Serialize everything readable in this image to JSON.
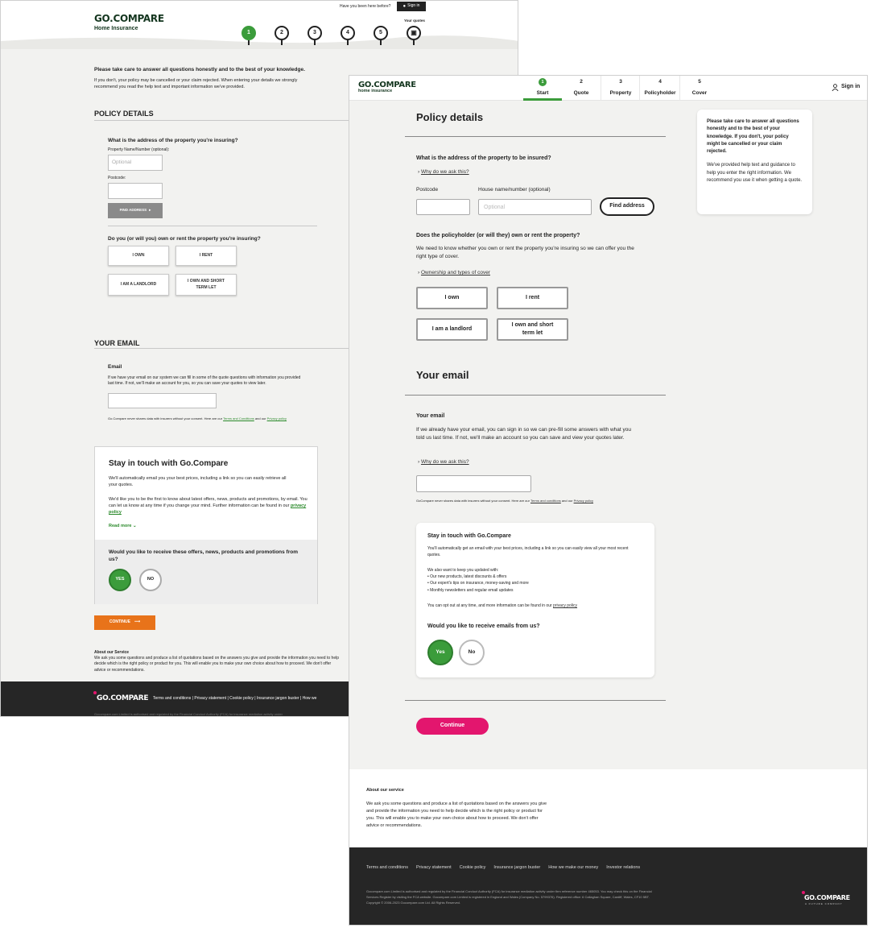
{
  "old": {
    "logo": "GO.COMPARE",
    "product": "Home Insurance",
    "been_before": "Have you been here before?",
    "sign_in": "Sign in",
    "your_quotes": "Your quotes",
    "steps": [
      "1",
      "2",
      "3",
      "4",
      "5"
    ],
    "intro_heading": "Please take care to answer all questions honestly and to the best of your knowledge.",
    "intro_text": "If you don't, your policy may be cancelled or your claim rejected. When entering your details we strongly recommend you read the help text and important information we've provided.",
    "policy_details": "POLICY DETAILS",
    "address_q": "What is the address of the property you're insuring?",
    "prop_name_label": "Property Name/Number (optional):",
    "prop_name_placeholder": "Optional",
    "postcode_label": "Postcode:",
    "find_address": "FIND ADDRESS",
    "own_rent_q": "Do you (or will you) own or rent the property you're insuring?",
    "opts": [
      "I OWN",
      "I RENT",
      "I AM A LANDLORD",
      "I OWN AND SHORT TERM LET"
    ],
    "your_email": "YOUR EMAIL",
    "email_label": "Email",
    "email_help": "If we have your email on our system we can fill in some of the quote questions with information you provided last time. If not, we'll make an account for you, so you can save your quotes to view later.",
    "privacy_pre": "Go.Compare never shares data with insurers without your consent. Here are our ",
    "terms": "Terms and Conditions",
    "and_our": " and our ",
    "privacy": "Privacy policy",
    "stay_title": "Stay in touch with Go.Compare",
    "stay_p1": "We'll automatically email you your best prices, including a link so you can easily retrieve all your quotes.",
    "stay_p2": "We'd like you to be the first to know about latest offers, news, products and promotions, by email. You can let us know at any time if you change your mind. Further information can be found in our ",
    "privacy_policy": "privacy policy",
    "read_more": "Read more",
    "offers_q": "Would you like to receive these offers, news, products and promotions from us?",
    "yes": "YES",
    "no": "NO",
    "continue": "CONTINUE",
    "about_title": "About our Service",
    "about_text": "We ask you some questions and produce a list of quotations based on the answers you give and provide the information you need to help decide which is the right policy or product for you. This will enable you to make your own choice about how to proceed. We don't offer advice or recommendations.",
    "footer_logo": "GO.COMPARE",
    "footer_links": [
      "Terms and conditions",
      "Privacy statement",
      "Cookie policy",
      "Insurance jargon buster",
      "How we"
    ],
    "footer_legal": "Gocompare.com Limited is authorised and regulated by the Financial Conduct Authority (FCA) for insurance mediation activity under"
  },
  "new": {
    "logo": "GO.COMPARE",
    "product": "home insurance",
    "tabs": [
      {
        "num": "1",
        "label": "Start"
      },
      {
        "num": "2",
        "label": "Quote"
      },
      {
        "num": "3",
        "label": "Property"
      },
      {
        "num": "4",
        "label": "Policyholder"
      },
      {
        "num": "5",
        "label": "Cover"
      }
    ],
    "sign_in": "Sign in",
    "policy_details": "Policy details",
    "address_q": "What is the address of the property to be insured?",
    "why_ask": "Why do we ask this?",
    "postcode_label": "Postcode",
    "house_label": "House name/number (optional)",
    "house_placeholder": "Optional",
    "find_address": "Find address",
    "own_rent_q": "Does the policyholder (or will they) own or rent the property?",
    "own_rent_help": "We need to know whether you own or rent the property you're insuring so we can offer you the right type of cover.",
    "ownership_link": "Ownership and types of cover",
    "opts": [
      "I own",
      "I rent",
      "I am a landlord",
      "I own and short term let"
    ],
    "aside_bold": "Please take care to answer all questions honestly and to the best of your knowledge. If you don't, your policy might be cancelled or your claim rejected.",
    "aside_text": "We've provided help text and guidance to help you enter the right information. We recommend you use it when getting a quote.",
    "your_email": "Your email",
    "email_label": "Your email",
    "email_help": "If we already have your email, you can sign in so we can pre-fill some answers with what you told us last time. If not, we'll make an account so you can save and view your quotes later.",
    "why_ask2": "Why do we ask this?",
    "privacy_pre": "GoCompare never shares data with insurers without your consent. Here are our ",
    "terms": "Terms and conditions",
    "and_our": " and our ",
    "privacy": "Privacy policy",
    "stay_title": "Stay in touch with Go.Compare",
    "stay_p1": "You'll automatically get an email with your best prices, including a link so you can easily view all your most recent quotes.",
    "stay_p2": "We also want to keep you updated with:",
    "stay_bullets": [
      "Our new products, latest discounts & offers",
      "Our expert's tips on insurance, money-saving and more",
      "Monthly newsletters and regular email updates"
    ],
    "stay_p3": "You can opt out at any time, and more information can be found in our ",
    "privacy_policy": "privacy policy",
    "emails_q": "Would you like to receive emails from us?",
    "yes": "Yes",
    "no": "No",
    "continue": "Continue",
    "about_title": "About our service",
    "about_text": "We ask you some questions and produce a list of quotations based on the answers you give and provide the information you need to help decide which is the right policy or product for you. This will enable you to make your own choice about how to proceed. We don't offer advice or recommendations.",
    "footer_links": [
      "Terms and conditions",
      "Privacy statement",
      "Cookie policy",
      "Insurance jargon buster",
      "How we make our money",
      "Investor relations"
    ],
    "footer_legal": "Gocompare.com Limited is authorised and regulated by the Financial Conduct Authority (FCA) for insurance mediation activity under firm reference number 465053. You may check this on the Financial Services Register by visiting the FCA website. Gocompare.com Limited is registered in England and Wales (Company No. 5799376). Registered office: 6 Callaghan Square, Cardiff, Wales, CF10 5BT. Copyright © 2006-2023 Gocompare.com Ltd. All Rights Reserved.",
    "footer_logo": "GO.COMPARE",
    "footer_tag": "A FUTURE COMPANY"
  },
  "colors": {
    "brand_green": "#3b9c3b",
    "dark_green": "#14361f",
    "orange": "#e8731a",
    "pink": "#e3166e",
    "footer": "#262626"
  }
}
